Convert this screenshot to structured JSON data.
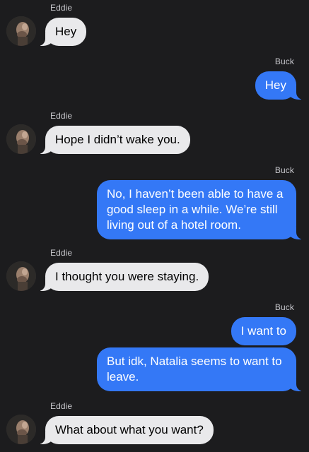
{
  "colors": {
    "background": "#1c1c1e",
    "incoming_bubble": "#e9e9eb",
    "outgoing_bubble": "#3478f6",
    "sender_label": "#c7c7cc"
  },
  "conversation": {
    "messages": [
      {
        "sender": "Eddie",
        "direction": "incoming",
        "text": "Hey"
      },
      {
        "sender": "Buck",
        "direction": "outgoing",
        "text": "Hey"
      },
      {
        "sender": "Eddie",
        "direction": "incoming",
        "text": "Hope I didn’t wake you."
      },
      {
        "sender": "Buck",
        "direction": "outgoing",
        "text": "No, I haven’t been able to have a good sleep in a while. We’re still living out of a hotel room."
      },
      {
        "sender": "Eddie",
        "direction": "incoming",
        "text": "I thought you were staying."
      },
      {
        "sender": "Buck",
        "direction": "outgoing",
        "text": "I want to"
      },
      {
        "sender": "",
        "direction": "outgoing",
        "text": "But idk, Natalia seems to want to leave."
      },
      {
        "sender": "Eddie",
        "direction": "incoming",
        "text": "What about what you want?"
      }
    ],
    "avatar_icon": "person-photo-avatar"
  }
}
